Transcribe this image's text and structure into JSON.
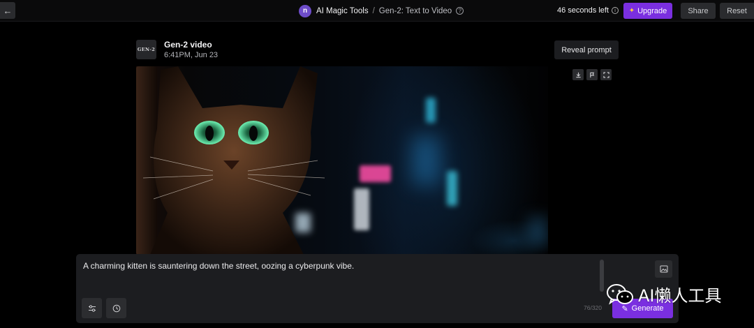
{
  "topbar": {
    "back_label": "←",
    "avatar_letter": "n",
    "breadcrumb_main": "AI Magic Tools",
    "breadcrumb_sep": "/",
    "breadcrumb_page": "Gen-2: Text to Video",
    "timer": "46 seconds left",
    "upgrade_label": "Upgrade",
    "share_label": "Share",
    "reset_label": "Reset"
  },
  "video": {
    "thumb_text": "GEN-2",
    "title": "Gen-2 video",
    "timestamp": "6:41PM, Jun 23",
    "reveal_label": "Reveal prompt"
  },
  "prompt": {
    "text": "A charming kitten is sauntering down the street, oozing a cyberpunk vibe.",
    "char_count": "76/320",
    "generate_label": "Generate"
  },
  "watermark": {
    "text": "AI懒人工具"
  },
  "colors": {
    "accent": "#7a2fe0",
    "background": "#000000",
    "panel": "#1c1d20"
  }
}
